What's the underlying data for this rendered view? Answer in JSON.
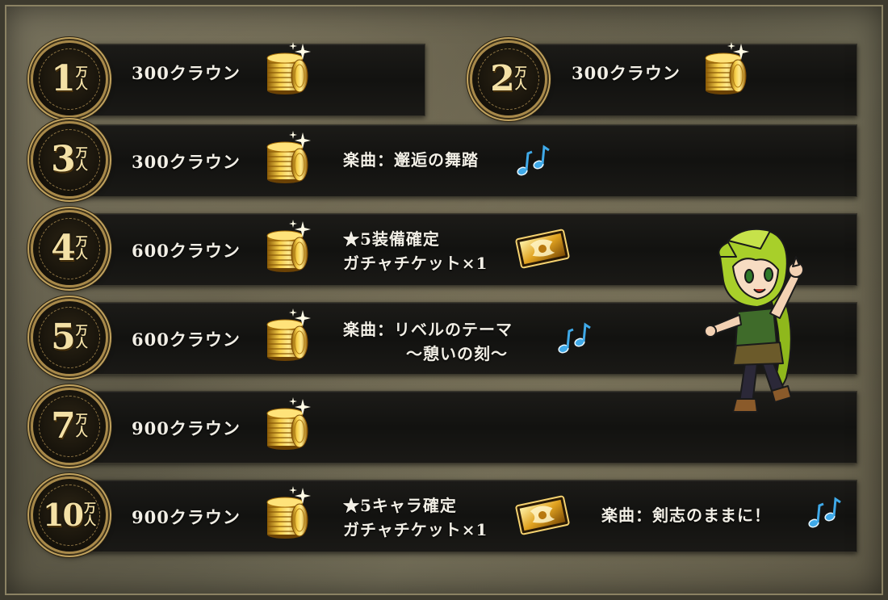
{
  "unit_label": "万人",
  "tiers": [
    {
      "id": "t1",
      "number": "1",
      "reward": "300クラウン"
    },
    {
      "id": "t2",
      "number": "2",
      "reward": "300クラウン"
    },
    {
      "id": "t3",
      "number": "3",
      "reward": "300クラウン",
      "song": "楽曲：邂逅の舞踏"
    },
    {
      "id": "t4",
      "number": "4",
      "reward": "600クラウン",
      "ticket_line1": "★5装備確定",
      "ticket_line2": "ガチャチケット×1"
    },
    {
      "id": "t5",
      "number": "5",
      "reward": "600クラウン",
      "song_line1": "楽曲：リベルのテーマ",
      "song_line2": "～憩いの刻～"
    },
    {
      "id": "t7",
      "number": "7",
      "reward": "900クラウン"
    },
    {
      "id": "t10",
      "number": "10",
      "reward": "900クラウン",
      "ticket_line1": "★5キャラ確定",
      "ticket_line2": "ガチャチケット×1",
      "song": "楽曲：剣志のままに！"
    }
  ],
  "icons": {
    "coin": "gold-coin-stack-icon",
    "note": "music-note-icon",
    "ticket": "gacha-ticket-icon",
    "character": "chibi-character-icon"
  },
  "colors": {
    "gold": "#f4e1a6",
    "bar": "#141311",
    "text": "#f2efe6",
    "note": "#3fa9e8"
  }
}
